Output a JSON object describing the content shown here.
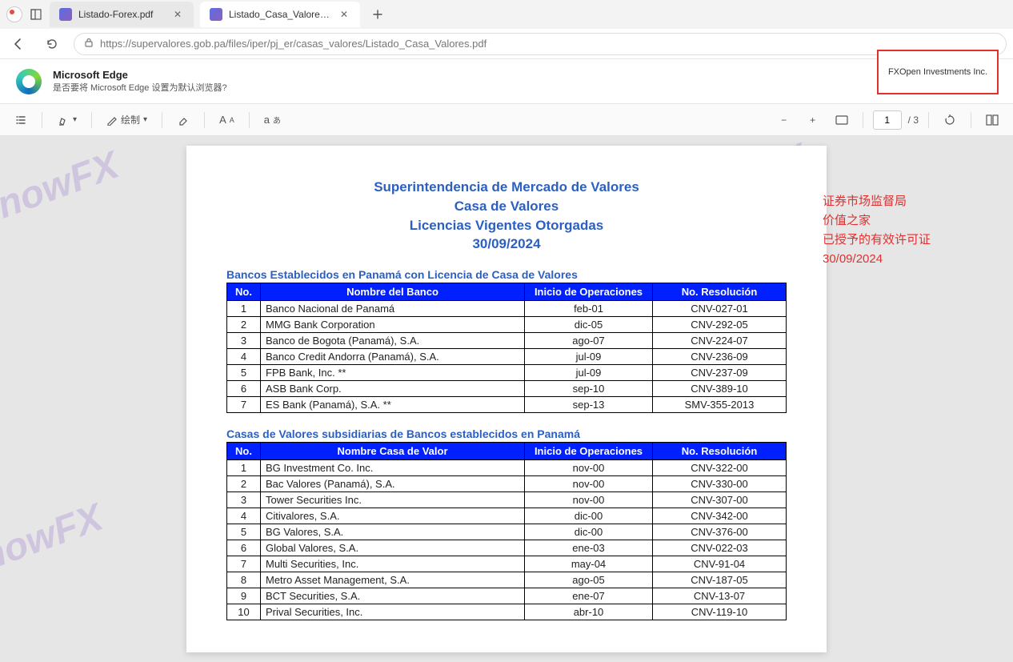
{
  "tabs": [
    {
      "title": "Listado-Forex.pdf",
      "active": false
    },
    {
      "title": "Listado_Casa_Valores.pdf",
      "active": true
    }
  ],
  "url": "https://supervalores.gob.pa/files/iper/pj_er/casas_valores/Listado_Casa_Valores.pdf",
  "edge_banner": {
    "title": "Microsoft Edge",
    "subtitle": "是否要将 Microsoft Edge 设置为默认浏览器?"
  },
  "pdf_toolbar": {
    "draw_label": "绘制",
    "page_current": "1",
    "page_total": "/ 3"
  },
  "highlight_text": "FXOpen Investments Inc.",
  "doc": {
    "title_l1": "Superintendencia de Mercado de Valores",
    "title_l2": "Casa de Valores",
    "title_l3": "Licencias  Vigentes Otorgadas",
    "title_l4": "30/09/2024",
    "translation": [
      "证券市场监督局",
      "价值之家",
      "已授予的有效许可证",
      "30/09/2024"
    ],
    "section1_title": "Bancos Establecidos en Panamá con Licencia de Casa de Valores",
    "headers1": [
      "No.",
      "Nombre del Banco",
      "Inicio de Operaciones",
      "No. Resolución"
    ],
    "rows1": [
      {
        "no": "1",
        "name": "Banco Nacional de Panamá",
        "date": "feb-01",
        "res": "CNV-027-01"
      },
      {
        "no": "2",
        "name": "MMG Bank Corporation",
        "date": "dic-05",
        "res": "CNV-292-05"
      },
      {
        "no": "3",
        "name": "Banco de Bogota (Panamá), S.A.",
        "date": "ago-07",
        "res": "CNV-224-07"
      },
      {
        "no": "4",
        "name": "Banco Credit Andorra (Panamá), S.A.",
        "date": "jul-09",
        "res": "CNV-236-09"
      },
      {
        "no": "5",
        "name": "FPB Bank, Inc. **",
        "date": "jul-09",
        "res": "CNV-237-09"
      },
      {
        "no": "6",
        "name": "ASB Bank Corp.",
        "date": "sep-10",
        "res": "CNV-389-10"
      },
      {
        "no": "7",
        "name": "ES Bank (Panamá), S.A. **",
        "date": "sep-13",
        "res": "SMV-355-2013"
      }
    ],
    "section2_title": "Casas de Valores  subsidiarias  de Bancos establecidos en Panamá",
    "headers2": [
      "No.",
      "Nombre Casa de Valor",
      "Inicio de Operaciones",
      "No. Resolución"
    ],
    "rows2": [
      {
        "no": "1",
        "name": "BG Investment Co. Inc.",
        "date": "nov-00",
        "res": "CNV-322-00"
      },
      {
        "no": "2",
        "name": "Bac Valores (Panamá), S.A.",
        "date": "nov-00",
        "res": "CNV-330-00"
      },
      {
        "no": "3",
        "name": "Tower Securities Inc.",
        "date": "nov-00",
        "res": "CNV-307-00"
      },
      {
        "no": "4",
        "name": "Citivalores, S.A.",
        "date": "dic-00",
        "res": "CNV-342-00"
      },
      {
        "no": "5",
        "name": "BG Valores, S.A.",
        "date": "dic-00",
        "res": "CNV-376-00"
      },
      {
        "no": "6",
        "name": "Global Valores, S.A.",
        "date": "ene-03",
        "res": "CNV-022-03"
      },
      {
        "no": "7",
        "name": "Multi Securities, Inc.",
        "date": "may-04",
        "res": "CNV-91-04"
      },
      {
        "no": "8",
        "name": "Metro Asset Management, S.A.",
        "date": "ago-05",
        "res": "CNV-187-05"
      },
      {
        "no": "9",
        "name": "BCT Securities, S.A.",
        "date": "ene-07",
        "res": "CNV-13-07"
      },
      {
        "no": "10",
        "name": "Prival Securities, Inc.",
        "date": "abr-10",
        "res": "CNV-119-10"
      }
    ]
  },
  "watermark": "KnowFX"
}
